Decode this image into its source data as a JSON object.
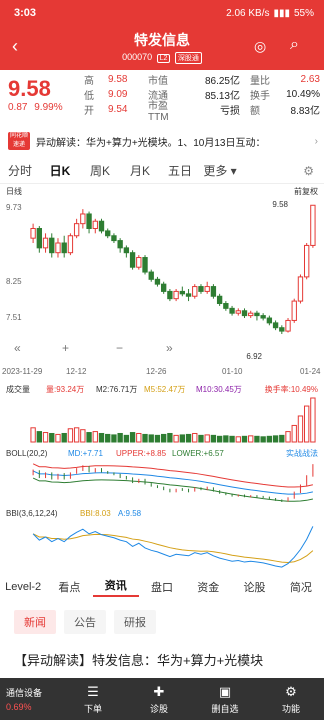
{
  "status": {
    "time": "3:03",
    "speed": "2.06 KB/s",
    "battery": "55%"
  },
  "header": {
    "name": "特发信息",
    "code": "000070",
    "tags": [
      "L2",
      "深股通"
    ]
  },
  "quote": {
    "price": "9.58",
    "change": "0.87",
    "change_pct": "9.99%",
    "rows": [
      {
        "l1": "高",
        "v1": "9.58",
        "l2": "市值",
        "v2": "86.25亿",
        "l3": "量比",
        "v3": "2.63"
      },
      {
        "l1": "低",
        "v1": "9.09",
        "l2": "流通",
        "v2": "85.13亿",
        "l3": "换手",
        "v3": "10.49%"
      },
      {
        "l1": "开",
        "v1": "9.54",
        "l2": "市盈TTM",
        "v2": "亏损",
        "l3": "额",
        "v3": "8.83亿"
      }
    ]
  },
  "news_strip": {
    "logo": "同花顺 速递",
    "text": "异动解读：华为+算力+光模块。1、10月13日互动："
  },
  "period_tabs": [
    "分时",
    "日K",
    "周K",
    "月K",
    "五日",
    "更多"
  ],
  "chart": {
    "label_day": "日线",
    "label_fq": "前复权",
    "y_labels": [
      "9.73",
      "8.25",
      "7.51"
    ],
    "max_label": "9.58",
    "min_label": "6.92",
    "x_labels": [
      "2023-11-29",
      "12-12",
      "12-26",
      "01-10",
      "01-24"
    ],
    "vol_title": "成交量",
    "vol_legend": [
      "量:93.24万",
      "M2:76.71万",
      "M5:52.47万",
      "M10:30.45万"
    ],
    "turnover": "换手率:10.49%",
    "boll_title": "BOLL(20,2)",
    "boll_legend": [
      "MD:+7.71",
      "UPPER:+8.85",
      "LOWER:+6.57"
    ],
    "boll_link": "实战战法",
    "bbi_title": "BBI(3,6,12,24)",
    "bbi_legend": [
      "BBI:8.03",
      "A:9.58"
    ]
  },
  "chart_data": {
    "type": "candlestick",
    "title": "",
    "ylim": [
      6.92,
      9.73
    ],
    "values": [
      [
        8.9,
        9.1,
        8.8,
        9.2
      ],
      [
        9.1,
        8.7,
        8.6,
        9.15
      ],
      [
        8.7,
        8.9,
        8.6,
        9.0
      ],
      [
        8.9,
        8.6,
        8.5,
        9.0
      ],
      [
        8.6,
        8.8,
        8.5,
        8.9
      ],
      [
        8.8,
        8.6,
        8.5,
        8.95
      ],
      [
        8.6,
        8.95,
        8.55,
        9.0
      ],
      [
        8.95,
        9.2,
        8.9,
        9.3
      ],
      [
        9.2,
        9.4,
        9.1,
        9.5
      ],
      [
        9.4,
        9.1,
        9.0,
        9.45
      ],
      [
        9.1,
        9.25,
        9.0,
        9.3
      ],
      [
        9.25,
        9.05,
        9.0,
        9.3
      ],
      [
        9.05,
        8.95,
        8.9,
        9.1
      ],
      [
        8.95,
        8.85,
        8.8,
        9.0
      ],
      [
        8.85,
        8.7,
        8.6,
        8.9
      ],
      [
        8.7,
        8.6,
        8.5,
        8.75
      ],
      [
        8.6,
        8.3,
        8.25,
        8.65
      ],
      [
        8.3,
        8.5,
        8.25,
        8.55
      ],
      [
        8.5,
        8.2,
        8.15,
        8.55
      ],
      [
        8.2,
        8.05,
        8.0,
        8.25
      ],
      [
        8.05,
        7.95,
        7.9,
        8.1
      ],
      [
        7.95,
        7.8,
        7.75,
        8.0
      ],
      [
        7.8,
        7.65,
        7.6,
        7.85
      ],
      [
        7.65,
        7.8,
        7.6,
        7.85
      ],
      [
        7.8,
        7.75,
        7.7,
        7.9
      ],
      [
        7.75,
        7.7,
        7.6,
        7.85
      ],
      [
        7.7,
        7.9,
        7.65,
        7.95
      ],
      [
        7.9,
        7.8,
        7.75,
        7.95
      ],
      [
        7.8,
        7.9,
        7.75,
        8.0
      ],
      [
        7.9,
        7.7,
        7.65,
        7.95
      ],
      [
        7.7,
        7.55,
        7.5,
        7.75
      ],
      [
        7.55,
        7.45,
        7.4,
        7.6
      ],
      [
        7.45,
        7.35,
        7.3,
        7.5
      ],
      [
        7.35,
        7.4,
        7.3,
        7.45
      ],
      [
        7.4,
        7.3,
        7.25,
        7.45
      ],
      [
        7.3,
        7.35,
        7.25,
        7.4
      ],
      [
        7.35,
        7.3,
        7.2,
        7.4
      ],
      [
        7.3,
        7.25,
        7.2,
        7.35
      ],
      [
        7.25,
        7.15,
        7.1,
        7.3
      ],
      [
        7.15,
        7.05,
        7.0,
        7.2
      ],
      [
        7.05,
        6.98,
        6.92,
        7.1
      ],
      [
        6.98,
        7.2,
        6.95,
        7.25
      ],
      [
        7.2,
        7.6,
        7.15,
        7.65
      ],
      [
        7.6,
        8.1,
        7.55,
        8.15
      ],
      [
        8.1,
        8.75,
        8.05,
        8.8
      ],
      [
        8.75,
        9.58,
        8.7,
        9.58
      ]
    ],
    "volumes": [
      30,
      22,
      20,
      18,
      16,
      18,
      28,
      30,
      26,
      20,
      22,
      18,
      16,
      15,
      18,
      14,
      20,
      18,
      16,
      15,
      14,
      16,
      18,
      14,
      15,
      16,
      18,
      14,
      15,
      14,
      12,
      13,
      12,
      11,
      12,
      13,
      12,
      11,
      12,
      13,
      14,
      22,
      35,
      55,
      76,
      93
    ],
    "x": [
      "2023-11-29",
      "12-12",
      "12-26",
      "01-10",
      "01-24"
    ]
  },
  "bottom_tabs": [
    "Level-2",
    "看点",
    "资讯",
    "盘口",
    "资金",
    "论股",
    "简况"
  ],
  "sub_tabs": [
    "新闻",
    "公告",
    "研报"
  ],
  "headline": "【异动解读】特发信息：华为+算力+光模块",
  "bottom_bar": {
    "stock": "通信设备",
    "pct": "0.69%",
    "items": [
      {
        "icon": "☰",
        "label": "下单"
      },
      {
        "icon": "✚",
        "label": "诊股"
      },
      {
        "icon": "▣",
        "label": "删自选"
      },
      {
        "icon": "⚙",
        "label": "功能"
      }
    ]
  },
  "colors": {
    "up": "#e53935",
    "down": "#2e7d32",
    "accent": "#e53935"
  }
}
